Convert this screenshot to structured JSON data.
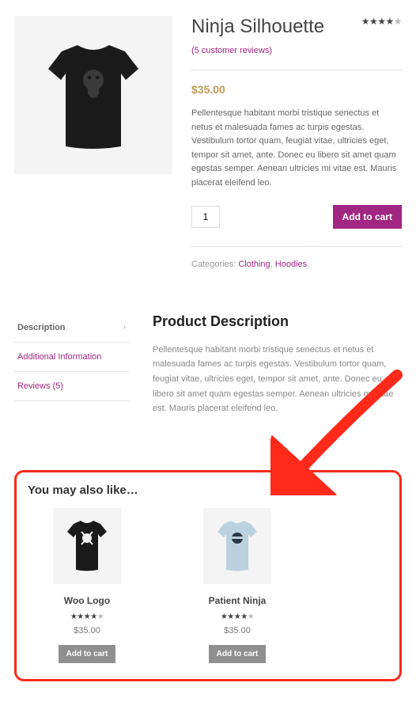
{
  "product": {
    "title": "Ninja Silhouette",
    "reviews_link": "(5 customer reviews)",
    "rating": 4,
    "price": "$35.00",
    "description": "Pellentesque habitant morbi tristique senectus et netus et malesuada fames ac turpis egestas. Vestibulum tortor quam, feugiat vitae, ultricies eget, tempor sit amet, ante. Donec eu libero sit amet quam egestas semper. Aenean ultricies mi vitae est. Mauris placerat eleifend leo.",
    "qty": "1",
    "add_to_cart": "Add to cart",
    "meta_label": "Categories: ",
    "categories": [
      "Clothing",
      "Hoodies"
    ],
    "image_alt": "black t-shirt with ninja silhouette"
  },
  "tabs": {
    "items": [
      {
        "label": "Description",
        "active": true
      },
      {
        "label": "Additional Information",
        "active": false
      },
      {
        "label": "Reviews (5)",
        "active": false
      }
    ]
  },
  "tab_content": {
    "heading": "Product Description",
    "body": "Pellentesque habitant morbi tristique senectus et netus et malesuada fames ac turpis egestas. Vestibulum tortor quam, feugiat vitae, ultricies eget, tempor sit amet, ante. Donec eu libero sit amet quam egestas semper. Aenean ultricies mi vitae est. Mauris placerat eleifend leo."
  },
  "upsell": {
    "heading": "You may also like…",
    "add_to_cart": "Add to cart",
    "products": [
      {
        "name": "Woo Logo",
        "rating": 4,
        "price": "$35.00",
        "color": "#1a1a1a",
        "graphic": "skull"
      },
      {
        "name": "Patient Ninja",
        "rating": 4.5,
        "price": "$35.00",
        "color": "#bcd1de",
        "graphic": "ninja"
      }
    ]
  }
}
